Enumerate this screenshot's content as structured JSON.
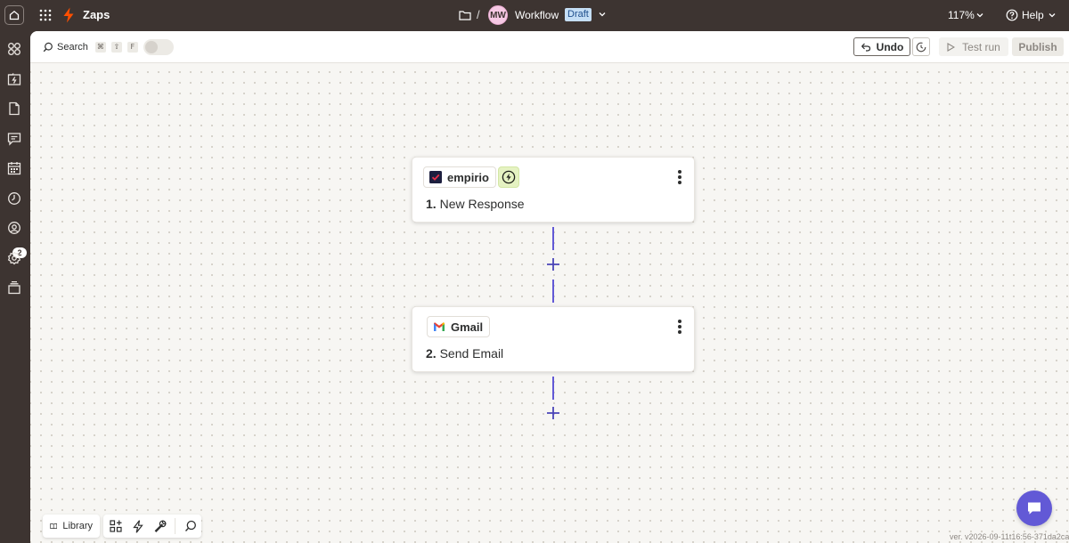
{
  "topbar": {
    "app_label": "Zaps",
    "avatar_initials": "MW",
    "workflow_name": "Workflow",
    "status_badge": "Draft",
    "zoom": "117%",
    "help_label": "Help",
    "icons": [
      "home-icon",
      "apps-grid-icon",
      "zap-bolt-icon",
      "folder-icon",
      "chevron-down-icon",
      "help-circle-icon"
    ]
  },
  "sidebar": {
    "items": [
      {
        "name": "apps-icon"
      },
      {
        "name": "zaps-icon"
      },
      {
        "name": "tables-icon"
      },
      {
        "name": "interfaces-icon"
      },
      {
        "name": "calendar-icon"
      },
      {
        "name": "history-icon"
      },
      {
        "name": "ai-agents-icon",
        "badge": "2"
      },
      {
        "name": "settings-icon"
      },
      {
        "name": "more-icon"
      }
    ]
  },
  "toolbar": {
    "search_label": "Search",
    "shortcut_keys": [
      "⌘",
      "⇧",
      "F"
    ],
    "undo_label": "Undo",
    "test_run_label": "Test run",
    "publish_label": "Publish"
  },
  "steps": [
    {
      "app": "empirio",
      "number": "1.",
      "title": "New Response",
      "is_trigger": true
    },
    {
      "app": "Gmail",
      "number": "2.",
      "title": "Send Email",
      "is_trigger": false
    }
  ],
  "bottom": {
    "library_label": "Library"
  },
  "version": "ver. v2026-09-11t16:56-371da2ca",
  "colors": {
    "chrome": "#3d3431",
    "accent": "#6259d6",
    "draft_badge": "#c5def5",
    "canvas": "#f7f6f3",
    "zap_orange": "#ff4f00"
  }
}
